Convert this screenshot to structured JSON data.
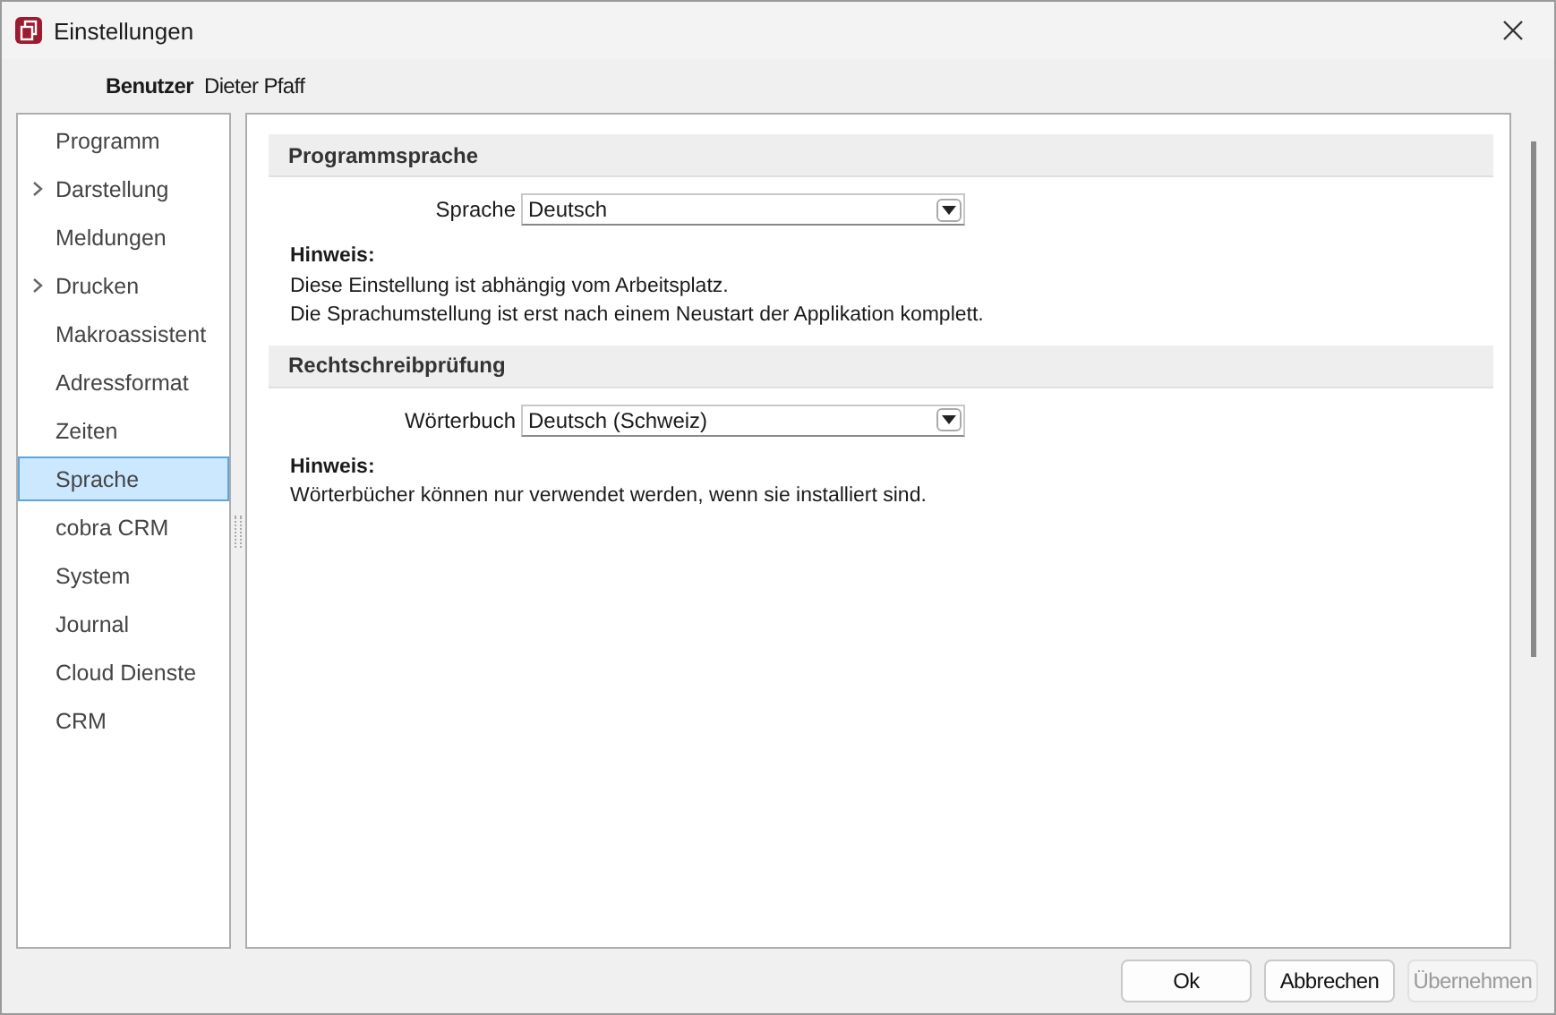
{
  "window": {
    "title": "Einstellungen"
  },
  "user": {
    "label": "Benutzer",
    "value": "Dieter Pfaff"
  },
  "sidebar": {
    "items": [
      {
        "label": "Programm",
        "kind": "leaf",
        "selected": false
      },
      {
        "label": "Darstellung",
        "kind": "group",
        "selected": false
      },
      {
        "label": "Meldungen",
        "kind": "leaf",
        "selected": false
      },
      {
        "label": "Drucken",
        "kind": "group",
        "selected": false
      },
      {
        "label": "Makroassistent",
        "kind": "leaf",
        "selected": false
      },
      {
        "label": "Adressformat",
        "kind": "leaf",
        "selected": false
      },
      {
        "label": "Zeiten",
        "kind": "leaf",
        "selected": false
      },
      {
        "label": "Sprache",
        "kind": "leaf",
        "selected": true
      },
      {
        "label": "cobra CRM",
        "kind": "leaf",
        "selected": false
      },
      {
        "label": "System",
        "kind": "leaf",
        "selected": false
      },
      {
        "label": "Journal",
        "kind": "leaf",
        "selected": false
      },
      {
        "label": "Cloud Dienste",
        "kind": "leaf",
        "selected": false
      },
      {
        "label": "CRM",
        "kind": "leaf",
        "selected": false
      }
    ]
  },
  "sections": [
    {
      "title": "Programmsprache",
      "field": {
        "label": "Sprache",
        "value": "Deutsch"
      },
      "note_title": "Hinweis:",
      "note_lines": [
        "Diese Einstellung ist abhängig vom Arbeitsplatz.",
        "Die Sprachumstellung ist erst nach einem Neustart der Applikation komplett."
      ]
    },
    {
      "title": "Rechtschreibprüfung",
      "field": {
        "label": "Wörterbuch",
        "value": "Deutsch (Schweiz)"
      },
      "note_title": "Hinweis:",
      "note_lines": [
        "Wörterbücher können nur verwendet werden, wenn sie installiert sind."
      ]
    }
  ],
  "buttons": [
    {
      "label": "Ok",
      "disabled": false
    },
    {
      "label": "Abbrechen",
      "disabled": false
    },
    {
      "label": "Übernehmen",
      "disabled": true
    }
  ]
}
